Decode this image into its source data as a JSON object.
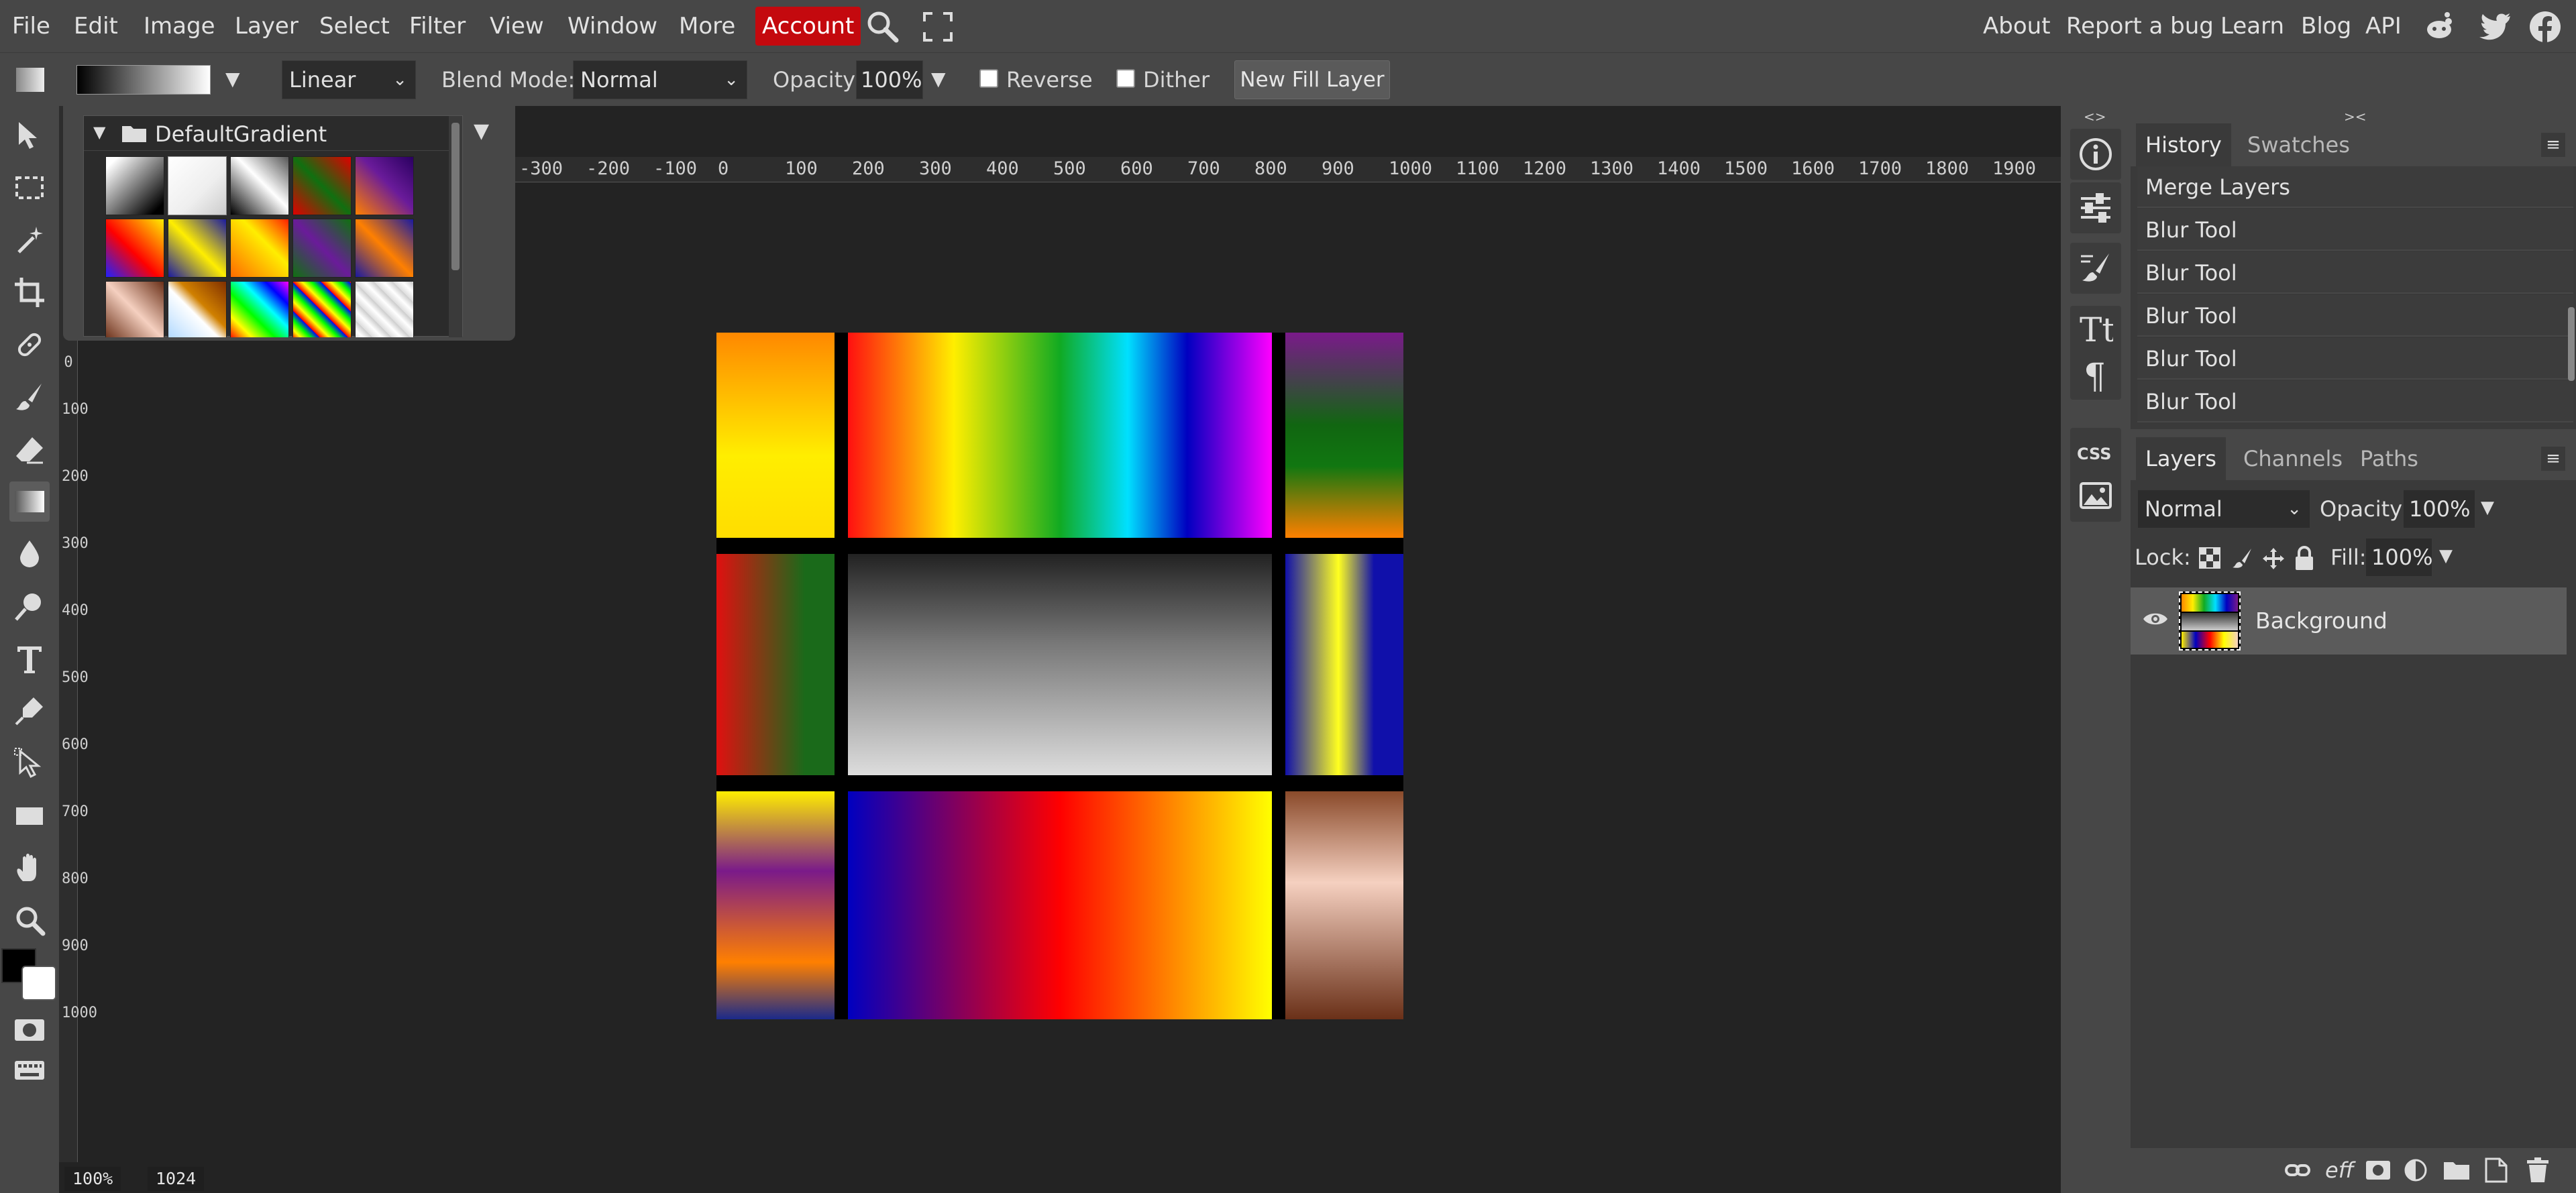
{
  "menu": {
    "items": [
      "File",
      "Edit",
      "Image",
      "Layer",
      "Select",
      "Filter",
      "View",
      "Window",
      "More"
    ],
    "account": "Account",
    "right_items": [
      "About",
      "Report a bug",
      "Learn",
      "Blog",
      "API"
    ]
  },
  "toolbar": {
    "gradient_type": "Linear",
    "blend_label": "Blend Mode:",
    "blend_value": "Normal",
    "opacity_label": "Opacity:",
    "opacity_value": "100%",
    "reverse_label": "Reverse",
    "dither_label": "Dither",
    "new_fill_label": "New Fill Layer"
  },
  "gradient_popup": {
    "folder_name": "DefaultGradient"
  },
  "ruler": {
    "h_ticks": [
      "-300",
      "-200",
      "-100",
      "0",
      "100",
      "200",
      "300",
      "400",
      "500",
      "600",
      "700",
      "800",
      "900",
      "1000",
      "1100",
      "1200",
      "1300",
      "1400",
      "1500",
      "1600",
      "1700",
      "1800",
      "1900"
    ],
    "v_ticks": [
      "0",
      "100",
      "200",
      "300",
      "400",
      "500",
      "600",
      "700",
      "800",
      "900",
      "1000"
    ]
  },
  "status": {
    "zoom": "100%",
    "size": "1024 × 1024"
  },
  "history": {
    "tabs": [
      "History",
      "Swatches"
    ],
    "items": [
      "Merge Layers",
      "Blur Tool",
      "Blur Tool",
      "Blur Tool",
      "Blur Tool",
      "Blur Tool"
    ]
  },
  "layers": {
    "tabs": [
      "Layers",
      "Channels",
      "Paths"
    ],
    "blend": "Normal",
    "opacity_label": "Opacity:",
    "opacity_value": "100%",
    "lock_label": "Lock:",
    "fill_label": "Fill:",
    "fill_value": "100%",
    "layer_name": "Background",
    "bottom_icons": [
      "link-icon",
      "eff",
      "mask-icon",
      "adjustment-icon",
      "folder-icon",
      "new-layer-icon",
      "trash-icon"
    ],
    "effects_label": "eff"
  },
  "colors": {
    "accent_account": "#c4090e",
    "panel_bg": "#474747",
    "workspace_bg": "#232323"
  }
}
